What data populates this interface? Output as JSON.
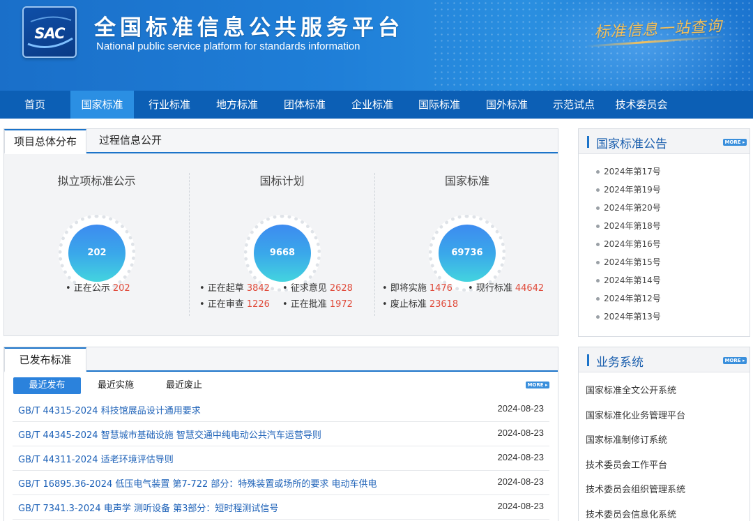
{
  "header": {
    "logo_text": "SAC",
    "title": "全国标准信息公共服务平台",
    "subtitle": "National public service platform  for standards information",
    "slogan": "标准信息一站查询"
  },
  "nav": [
    {
      "label": "首页",
      "active": false
    },
    {
      "label": "国家标准",
      "active": true
    },
    {
      "label": "行业标准",
      "active": false
    },
    {
      "label": "地方标准",
      "active": false
    },
    {
      "label": "团体标准",
      "active": false
    },
    {
      "label": "企业标准",
      "active": false
    },
    {
      "label": "国际标准",
      "active": false
    },
    {
      "label": "国外标准",
      "active": false
    },
    {
      "label": "示范试点",
      "active": false
    },
    {
      "label": "技术委员会",
      "active": false
    }
  ],
  "overview": {
    "tabs": [
      "项目总体分布",
      "过程信息公开"
    ],
    "columns": [
      {
        "title": "拟立项标准公示",
        "total": "202",
        "rows": [
          [
            {
              "label": "正在公示",
              "value": "202"
            }
          ]
        ]
      },
      {
        "title": "国标计划",
        "total": "9668",
        "rows": [
          [
            {
              "label": "正在起草",
              "value": "3842"
            },
            {
              "label": "征求意见",
              "value": "2628"
            }
          ],
          [
            {
              "label": "正在审查",
              "value": "1226"
            },
            {
              "label": "正在批准",
              "value": "1972"
            }
          ]
        ]
      },
      {
        "title": "国家标准",
        "total": "69736",
        "rows": [
          [
            {
              "label": "即将实施",
              "value": "1476"
            },
            {
              "label": "现行标准",
              "value": "44642"
            }
          ],
          [
            {
              "label": "废止标准",
              "value": "23618"
            }
          ]
        ]
      }
    ]
  },
  "published": {
    "tab": "已发布标准",
    "subtabs": [
      "最近发布",
      "最近实施",
      "最近废止"
    ],
    "more": "MORE ▸",
    "items": [
      {
        "title": "GB/T 44315-2024 科技馆展品设计通用要求",
        "date": "2024-08-23"
      },
      {
        "title": "GB/T 44345-2024 智慧城市基础设施 智慧交通中纯电动公共汽车运营导则",
        "date": "2024-08-23"
      },
      {
        "title": "GB/T 44311-2024 适老环境评估导则",
        "date": "2024-08-23"
      },
      {
        "title": "GB/T 16895.36-2024 低压电气装置 第7-722 部分：特殊装置或场所的要求 电动车供电",
        "date": "2024-08-23"
      },
      {
        "title": "GB/T 7341.3-2024 电声学 测听设备 第3部分：短时程测试信号",
        "date": "2024-08-23"
      }
    ]
  },
  "announcements": {
    "title": "国家标准公告",
    "more": "MORE ▸",
    "items": [
      "2024年第17号",
      "2024年第19号",
      "2024年第20号",
      "2024年第18号",
      "2024年第16号",
      "2024年第15号",
      "2024年第14号",
      "2024年第12号",
      "2024年第13号"
    ]
  },
  "systems": {
    "title": "业务系统",
    "more": "MORE ▸",
    "items": [
      "国家标准全文公开系统",
      "国家标准化业务管理平台",
      "国家标准制修订系统",
      "技术委员会工作平台",
      "技术委员会组织管理系统",
      "技术委员会信息化系统"
    ]
  }
}
